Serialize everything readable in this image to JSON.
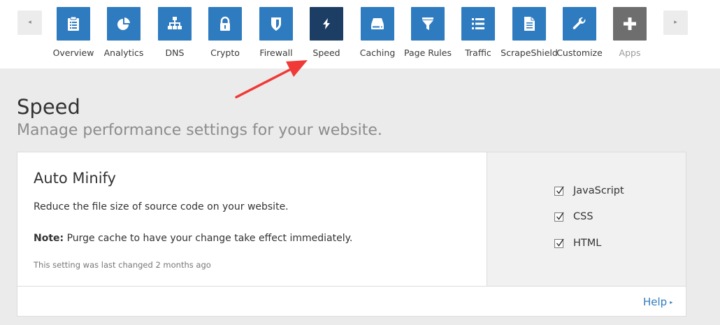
{
  "nav": {
    "scroll_left_glyph": "◂",
    "scroll_right_glyph": "▸",
    "items": [
      {
        "label": "Overview",
        "icon": "clipboard-icon",
        "color": "#2f7bbf"
      },
      {
        "label": "Analytics",
        "icon": "pie-chart-icon",
        "color": "#2f7bbf"
      },
      {
        "label": "DNS",
        "icon": "network-icon",
        "color": "#2f7bbf"
      },
      {
        "label": "Crypto",
        "icon": "lock-icon",
        "color": "#2f7bbf"
      },
      {
        "label": "Firewall",
        "icon": "shield-icon",
        "color": "#2f7bbf"
      },
      {
        "label": "Speed",
        "icon": "lightning-icon",
        "color": "#1d3e64",
        "active": true
      },
      {
        "label": "Caching",
        "icon": "hard-drive-icon",
        "color": "#2f7bbf"
      },
      {
        "label": "Page Rules",
        "icon": "filter-icon",
        "color": "#2f7bbf"
      },
      {
        "label": "Traffic",
        "icon": "list-icon",
        "color": "#2f7bbf"
      },
      {
        "label": "ScrapeShield",
        "icon": "document-icon",
        "color": "#2f7bbf"
      },
      {
        "label": "Customize",
        "icon": "wrench-icon",
        "color": "#2f7bbf"
      },
      {
        "label": "Apps",
        "icon": "plus-icon",
        "color": "#6e6e6e"
      }
    ]
  },
  "annotation": {
    "arrow_color": "#f03a37"
  },
  "page": {
    "title": "Speed",
    "subtitle": "Manage performance settings for your website."
  },
  "card": {
    "title": "Auto Minify",
    "description": "Reduce the file size of source code on your website.",
    "note_label": "Note:",
    "note_text": " Purge cache to have your change take effect immediately.",
    "last_changed": "This setting was last changed 2 months ago",
    "options": [
      {
        "label": "JavaScript",
        "checked": true
      },
      {
        "label": "CSS",
        "checked": true
      },
      {
        "label": "HTML",
        "checked": true
      }
    ],
    "help_label": "Help",
    "help_caret": "▸"
  }
}
